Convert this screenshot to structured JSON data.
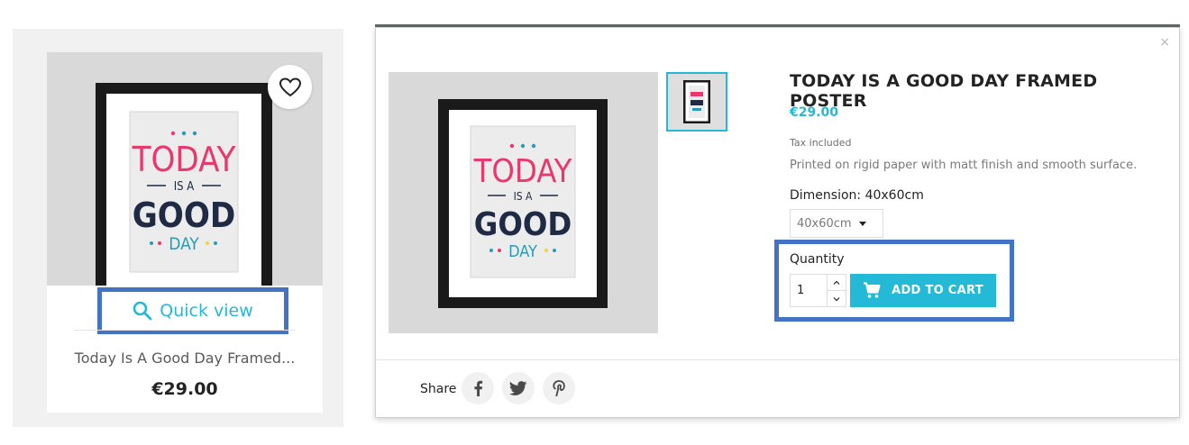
{
  "product_card": {
    "quick_view_label": "Quick view",
    "title": "Today Is A Good Day Framed...",
    "price": "€29.00",
    "wishlist_icon": "heart-icon",
    "quick_view_icon": "search-icon"
  },
  "poster": {
    "line1": "TODAY",
    "line2": "IS A",
    "line3": "GOOD",
    "line4": "DAY"
  },
  "modal": {
    "close_label": "×",
    "title": "TODAY IS A GOOD DAY FRAMED POSTER",
    "price": "€29.00",
    "tax_note": "Tax included",
    "description": "Printed on rigid paper with matt finish and smooth surface.",
    "dimension_label": "Dimension: 40x60cm",
    "dimension_selected": "40x60cm",
    "quantity_label": "Quantity",
    "quantity_value": "1",
    "add_to_cart_label": "ADD TO CART",
    "share_label": "Share",
    "share_icons": [
      "facebook-icon",
      "twitter-icon",
      "pinterest-icon"
    ]
  },
  "colors": {
    "accent": "#24b9d7",
    "highlight_box": "#4472c4",
    "poster_pink": "#e8386d",
    "poster_navy": "#1f2a44",
    "poster_teal": "#2a9bb5"
  }
}
